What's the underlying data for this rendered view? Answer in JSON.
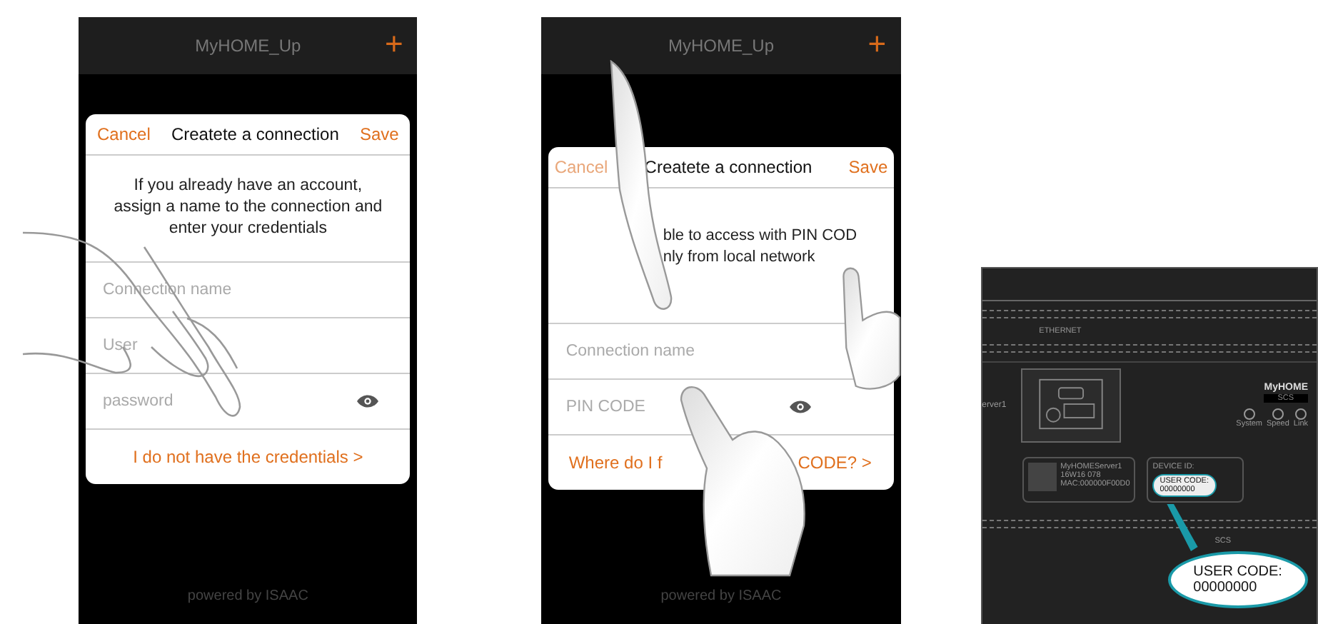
{
  "screens": [
    {
      "app_title": "MyHOME_Up",
      "add": "+",
      "dialog": {
        "cancel": "Cancel",
        "cancel_dimmed": false,
        "title": "Createte a connection",
        "save": "Save",
        "description": [
          "If you already have an account, assign a name to the connection and enter your credentials"
        ],
        "fields": [
          {
            "placeholder": "Connection name",
            "kind": "text"
          },
          {
            "placeholder": "User",
            "kind": "text"
          },
          {
            "placeholder": "password",
            "kind": "secret"
          }
        ],
        "link": [
          "I do not have the credentials >"
        ]
      },
      "footer": "powered by ISAAC"
    },
    {
      "app_title": "MyHOME_Up",
      "add": "+",
      "dialog": {
        "cancel": "Cancel",
        "cancel_dimmed": true,
        "title": "Createte a connection",
        "save": "Save",
        "description": [
          "ble to access with PIN COD",
          "nly from local network"
        ],
        "fields": [
          {
            "placeholder": "Connection name",
            "kind": "text"
          },
          {
            "placeholder": "PIN CODE",
            "kind": "secret"
          }
        ],
        "link": [
          "Where do I f",
          "CODE? >"
        ]
      },
      "footer": "powered by ISAAC"
    }
  ],
  "device": {
    "port_label": "ETHERNET",
    "brand": "MyHOME",
    "brand_sub": "SCS",
    "leds": [
      "System",
      "Speed",
      "Link"
    ],
    "side_label": "erver1",
    "product": {
      "name": "MyHOMEServer1",
      "code": "16W16 078",
      "mac": "MAC:000000F00D0"
    },
    "device_id_label": "DEVICE ID:",
    "user_code_label": "USER CODE:",
    "user_code": "00000000",
    "callout": {
      "label": "USER CODE:",
      "value": "00000000"
    },
    "bus_label": "SCS"
  }
}
